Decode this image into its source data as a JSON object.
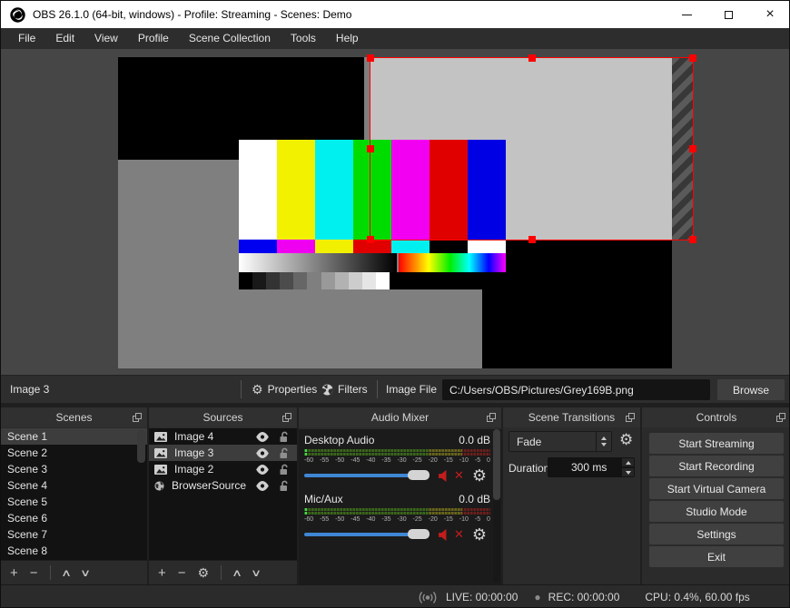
{
  "window": {
    "title": "OBS 26.1.0 (64-bit, windows) - Profile: Streaming - Scenes: Demo"
  },
  "menu": {
    "items": [
      "File",
      "Edit",
      "View",
      "Profile",
      "Scene Collection",
      "Tools",
      "Help"
    ]
  },
  "context_bar": {
    "selected_source": "Image 3",
    "properties": "Properties",
    "filters": "Filters",
    "image_file_label": "Image File",
    "image_file_path": "C:/Users/OBS/Pictures/Grey169B.png",
    "browse": "Browse"
  },
  "preview": {
    "selected_source": "Image 3",
    "color_bars": [
      "#ffffff",
      "#f2f200",
      "#00f0f0",
      "#00dc00",
      "#f200f2",
      "#e00000",
      "#0000e4"
    ],
    "castellation": [
      "#0000f0",
      "#f000f0",
      "#f0f000",
      "#e00000",
      "#00f0f0",
      "#000000",
      "#ffffff"
    ],
    "gray_steps": [
      "#000000",
      "#191919",
      "#333333",
      "#4c4c4c",
      "#666666",
      "#7f7f7f",
      "#999999",
      "#b2b2b2",
      "#cccccc",
      "#e5e5e5",
      "#ffffff"
    ],
    "spectrum": [
      "#ff0000",
      "#ffff00",
      "#00ee00",
      "#00ffff",
      "#0000ff",
      "#ff00ff"
    ]
  },
  "docks": {
    "scenes": {
      "title": "Scenes",
      "items": [
        "Scene 1",
        "Scene 2",
        "Scene 3",
        "Scene 4",
        "Scene 5",
        "Scene 6",
        "Scene 7",
        "Scene 8"
      ],
      "selected": "Scene 1"
    },
    "sources": {
      "title": "Sources",
      "items": [
        {
          "label": "Image 4",
          "icon": "image"
        },
        {
          "label": "Image 3",
          "icon": "image"
        },
        {
          "label": "Image 2",
          "icon": "image"
        },
        {
          "label": "BrowserSource",
          "icon": "browser"
        }
      ],
      "selected": "Image 3"
    },
    "audio_mixer": {
      "title": "Audio Mixer",
      "ticks": [
        "-60",
        "-55",
        "-50",
        "-45",
        "-40",
        "-35",
        "-30",
        "-25",
        "-20",
        "-15",
        "-10",
        "-5",
        "0"
      ],
      "channels": [
        {
          "name": "Desktop Audio",
          "level": "0.0 dB",
          "muted": true
        },
        {
          "name": "Mic/Aux",
          "level": "0.0 dB",
          "muted": true
        }
      ]
    },
    "scene_transitions": {
      "title": "Scene Transitions",
      "transition": "Fade",
      "duration_label": "Duration",
      "duration": "300 ms"
    },
    "controls": {
      "title": "Controls",
      "buttons": [
        "Start Streaming",
        "Start Recording",
        "Start Virtual Camera",
        "Studio Mode",
        "Settings",
        "Exit"
      ]
    }
  },
  "status_bar": {
    "live": "LIVE: 00:00:00",
    "rec": "REC: 00:00:00",
    "stats": "CPU: 0.4%, 60.00 fps"
  },
  "colors": {
    "selection-red": "#ff0000",
    "slider-blue": "#3f87d4",
    "mute-red": "#c41c1c",
    "meter-bright": "#45d945",
    "meter-green": "#3c651f",
    "meter-yellow": "#67641f",
    "meter-red": "#67231f"
  }
}
